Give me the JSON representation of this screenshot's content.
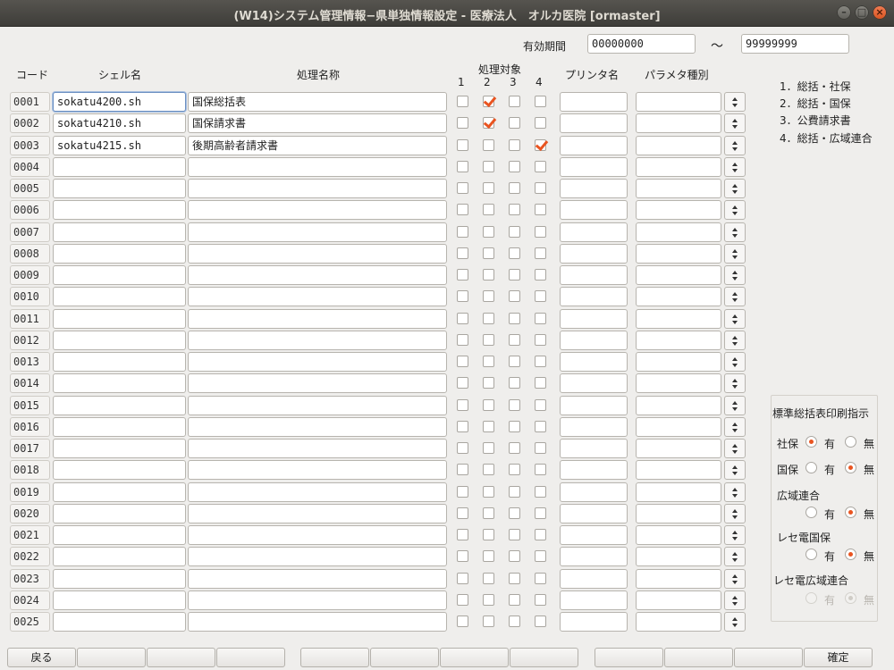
{
  "window": {
    "title": "(W14)システム管理情報−県単独情報設定 - 医療法人　オルカ医院  [ormaster]",
    "buttons": [
      "–",
      "□",
      "×"
    ]
  },
  "period": {
    "label": "有効期間",
    "from": "00000000",
    "tilde": "～",
    "to": "99999999"
  },
  "headers": {
    "code": "コード",
    "shell": "シェル名",
    "procname": "処理名称",
    "target": "処理対象",
    "t1": "1",
    "t2": "2",
    "t3": "3",
    "t4": "4",
    "printer": "プリンタ名",
    "param": "パラメタ種別"
  },
  "rows": [
    {
      "code": "0001",
      "shell": "sokatu4200.sh",
      "name": "国保総括表",
      "checks": [
        false,
        true,
        false,
        false
      ]
    },
    {
      "code": "0002",
      "shell": "sokatu4210.sh",
      "name": "国保請求書",
      "checks": [
        false,
        true,
        false,
        false
      ]
    },
    {
      "code": "0003",
      "shell": "sokatu4215.sh",
      "name": "後期高齢者請求書",
      "checks": [
        false,
        false,
        false,
        true
      ]
    },
    {
      "code": "0004",
      "shell": "",
      "name": "",
      "checks": [
        false,
        false,
        false,
        false
      ]
    },
    {
      "code": "0005",
      "shell": "",
      "name": "",
      "checks": [
        false,
        false,
        false,
        false
      ]
    },
    {
      "code": "0006",
      "shell": "",
      "name": "",
      "checks": [
        false,
        false,
        false,
        false
      ]
    },
    {
      "code": "0007",
      "shell": "",
      "name": "",
      "checks": [
        false,
        false,
        false,
        false
      ]
    },
    {
      "code": "0008",
      "shell": "",
      "name": "",
      "checks": [
        false,
        false,
        false,
        false
      ]
    },
    {
      "code": "0009",
      "shell": "",
      "name": "",
      "checks": [
        false,
        false,
        false,
        false
      ]
    },
    {
      "code": "0010",
      "shell": "",
      "name": "",
      "checks": [
        false,
        false,
        false,
        false
      ]
    },
    {
      "code": "0011",
      "shell": "",
      "name": "",
      "checks": [
        false,
        false,
        false,
        false
      ]
    },
    {
      "code": "0012",
      "shell": "",
      "name": "",
      "checks": [
        false,
        false,
        false,
        false
      ]
    },
    {
      "code": "0013",
      "shell": "",
      "name": "",
      "checks": [
        false,
        false,
        false,
        false
      ]
    },
    {
      "code": "0014",
      "shell": "",
      "name": "",
      "checks": [
        false,
        false,
        false,
        false
      ]
    },
    {
      "code": "0015",
      "shell": "",
      "name": "",
      "checks": [
        false,
        false,
        false,
        false
      ]
    },
    {
      "code": "0016",
      "shell": "",
      "name": "",
      "checks": [
        false,
        false,
        false,
        false
      ]
    },
    {
      "code": "0017",
      "shell": "",
      "name": "",
      "checks": [
        false,
        false,
        false,
        false
      ]
    },
    {
      "code": "0018",
      "shell": "",
      "name": "",
      "checks": [
        false,
        false,
        false,
        false
      ]
    },
    {
      "code": "0019",
      "shell": "",
      "name": "",
      "checks": [
        false,
        false,
        false,
        false
      ]
    },
    {
      "code": "0020",
      "shell": "",
      "name": "",
      "checks": [
        false,
        false,
        false,
        false
      ]
    },
    {
      "code": "0021",
      "shell": "",
      "name": "",
      "checks": [
        false,
        false,
        false,
        false
      ]
    },
    {
      "code": "0022",
      "shell": "",
      "name": "",
      "checks": [
        false,
        false,
        false,
        false
      ]
    },
    {
      "code": "0023",
      "shell": "",
      "name": "",
      "checks": [
        false,
        false,
        false,
        false
      ]
    },
    {
      "code": "0024",
      "shell": "",
      "name": "",
      "checks": [
        false,
        false,
        false,
        false
      ]
    },
    {
      "code": "0025",
      "shell": "",
      "name": "",
      "checks": [
        false,
        false,
        false,
        false
      ]
    }
  ],
  "legend": [
    "1．総括・社保",
    "2．総括・国保",
    "3．公費請求書",
    "4．総括・広域連合"
  ],
  "print_panel": {
    "title": "標準総括表印刷指示",
    "groups": [
      {
        "label": "社保",
        "yes": "有",
        "no": "無",
        "selected": "yes",
        "disabled": false
      },
      {
        "label": "国保",
        "yes": "有",
        "no": "無",
        "selected": "no",
        "disabled": false
      },
      {
        "label": "広域連合",
        "yes": "有",
        "no": "無",
        "selected": "no",
        "disabled": false
      },
      {
        "label": "レセ電国保",
        "yes": "有",
        "no": "無",
        "selected": "no",
        "disabled": false
      },
      {
        "label": "レセ電広域連合",
        "yes": "有",
        "no": "無",
        "selected": "no",
        "disabled": true
      }
    ]
  },
  "footer": {
    "buttons": [
      "戻る",
      "",
      "",
      "",
      "",
      "",
      "",
      "",
      "",
      "",
      "",
      "確定"
    ]
  }
}
